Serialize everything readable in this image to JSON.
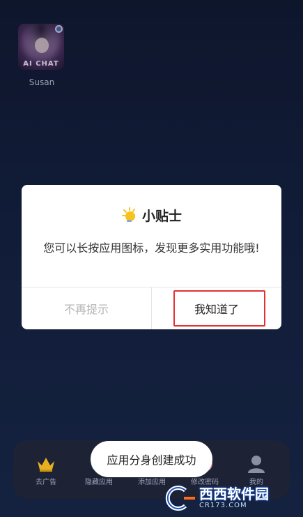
{
  "app": {
    "badge_text": "AI CHAT",
    "name": "Susan"
  },
  "dialog": {
    "title": "小贴士",
    "message": "您可以长按应用图标，发现更多实用功能哦!",
    "dismiss_label": "不再提示",
    "confirm_label": "我知道了"
  },
  "bottom_nav": {
    "items": [
      {
        "label": "去广告",
        "icon": "crown-icon"
      },
      {
        "label": "隐藏应用",
        "icon": "hide-icon"
      },
      {
        "label": "添加应用",
        "icon": "add-icon"
      },
      {
        "label": "修改密码",
        "icon": "lock-icon"
      },
      {
        "label": "我的",
        "icon": "profile-icon"
      }
    ]
  },
  "toast": {
    "text": "应用分身创建成功"
  },
  "watermark": {
    "text": "西西软件园",
    "url": "CR173.COM"
  },
  "colors": {
    "highlight": "#e53030",
    "bulb": "#f7c21a"
  }
}
